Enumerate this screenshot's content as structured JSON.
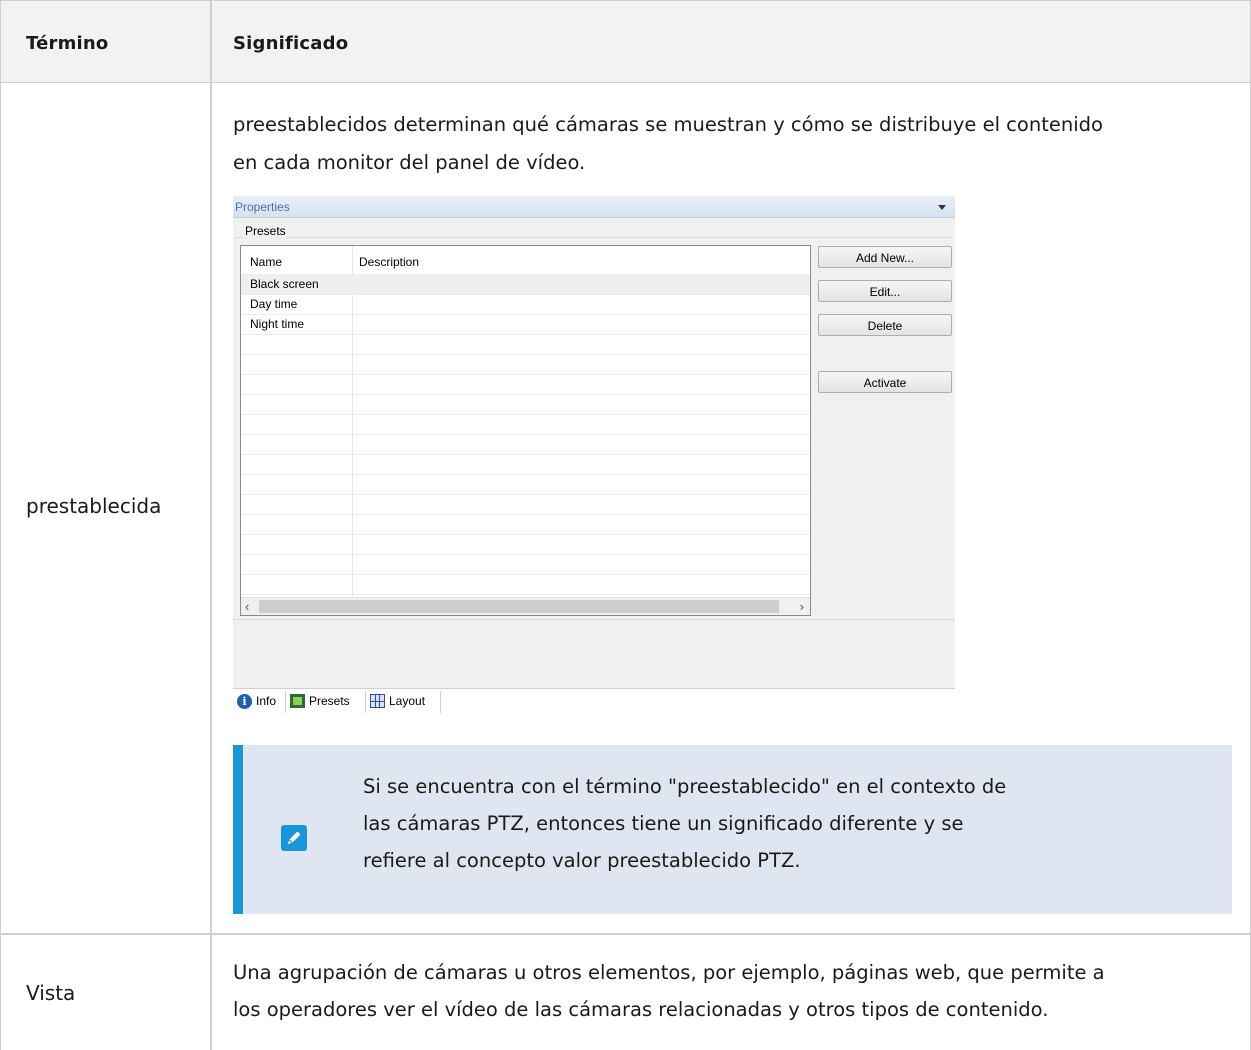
{
  "table": {
    "headers": {
      "term": "Término",
      "meaning": "Significado"
    },
    "rows": [
      {
        "term": "prestablecida",
        "text_line1": "preestablecidos determinan qué cámaras se muestran y cómo se distribuye el contenido",
        "text_line2": "en cada monitor del panel de vídeo.",
        "screenshot": {
          "title": "Properties",
          "group_label": "Presets",
          "columns": [
            "Name",
            "Description"
          ],
          "items": [
            "Black screen",
            "Day time",
            "Night time"
          ],
          "buttons": {
            "add_new": "Add New...",
            "edit": "Edit...",
            "delete": "Delete",
            "activate": "Activate"
          },
          "tabs": [
            {
              "label": "Info",
              "icon": "info-icon"
            },
            {
              "label": "Presets",
              "icon": "presets-icon"
            },
            {
              "label": "Layout",
              "icon": "layout-icon"
            }
          ]
        },
        "note": {
          "icon": "pencil-icon",
          "line1": "Si se encuentra con el término \"preestablecido\" en el contexto de",
          "line2": "las cámaras PTZ, entonces tiene un significado diferente y se",
          "line3": "refiere al concepto valor preestablecido PTZ."
        }
      },
      {
        "term": "Vista",
        "text_line1": "Una agrupación de cámaras u otros elementos, por ejemplo, páginas web, que permite a",
        "text_line2": "los operadores ver el vídeo de las cámaras relacionadas y otros tipos de contenido."
      }
    ]
  },
  "colors": {
    "note_accent": "#1796d8",
    "note_bg": "#dfe6f1",
    "header_bg": "#f2f2f2"
  }
}
